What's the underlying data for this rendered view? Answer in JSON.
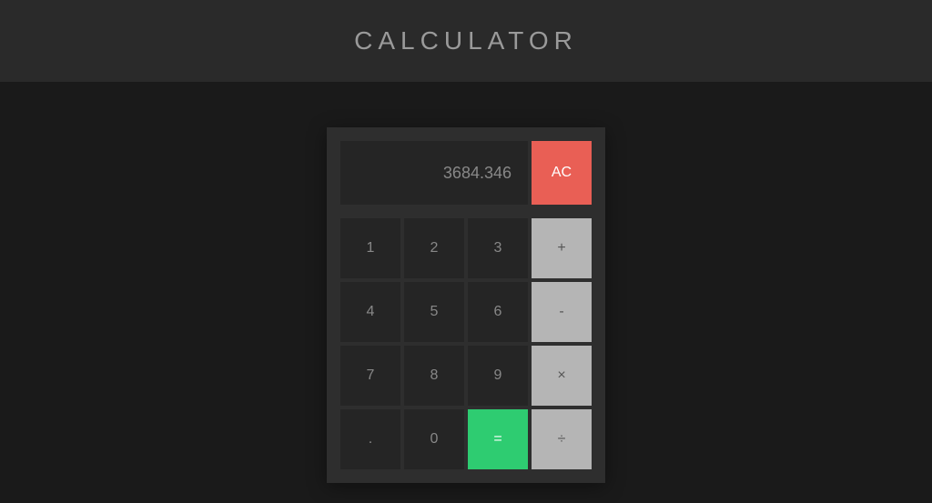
{
  "header": {
    "title": "CALCULATOR"
  },
  "calculator": {
    "display_value": "3684.346",
    "buttons": {
      "clear": "AC",
      "n1": "1",
      "n2": "2",
      "n3": "3",
      "n4": "4",
      "n5": "5",
      "n6": "6",
      "n7": "7",
      "n8": "8",
      "n9": "9",
      "n0": "0",
      "dot": ".",
      "add": "+",
      "subtract": "-",
      "multiply": "×",
      "divide": "÷",
      "equals": "="
    }
  }
}
